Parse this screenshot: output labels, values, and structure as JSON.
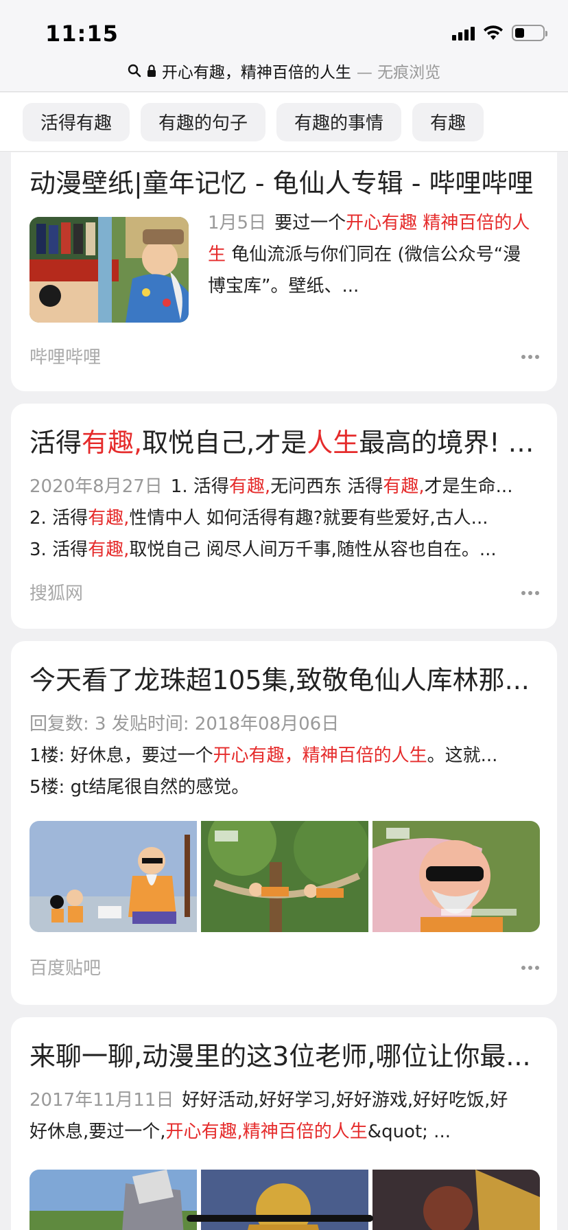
{
  "status": {
    "time": "11:15",
    "battery_level": 0.35
  },
  "url_bar": {
    "title": "开心有趣，精神百倍的人生",
    "mode": "— 无痕浏览"
  },
  "chips": [
    "活得有趣",
    "有趣的句子",
    "有趣的事情",
    "有趣"
  ],
  "results": [
    {
      "title": "动漫壁纸|童年记忆 - 龟仙人专辑 - 哔哩哔哩",
      "date": "1月5日",
      "snippet_parts": [
        "要过一个",
        "开心有趣 精神百倍的人生",
        " 龟仙流派与你们同在 (微信公众号“漫博宝库”。壁纸、..."
      ],
      "source": "哔哩哔哩"
    },
    {
      "title_parts": [
        "活得",
        "有趣,",
        "取悦自己,才是",
        "人生",
        "最高的境界! -..."
      ],
      "date": "2020年8月27日",
      "lines": [
        [
          "1. 活得",
          "有趣,",
          "无问西东 活得",
          "有趣,",
          "才是生命..."
        ],
        [
          "2. 活得",
          "有趣,",
          "性情中人 如何活得有趣?就要有些爱好,古人..."
        ],
        [
          "3. 活得",
          "有趣,",
          "取悦自己 阅尽人间万千事,随性从容也自在。..."
        ]
      ],
      "source": "搜狐网"
    },
    {
      "title": "今天看了龙珠超105集,致敬龟仙人库林那...",
      "meta": "回复数: 3  发贴时间: 2018年08月06日",
      "line1_parts": [
        "1楼: 好休息，要过一个",
        "开心有趣，精神百倍的人生",
        "。这就..."
      ],
      "line2": "5楼: gt结尾很自然的感觉。",
      "source": "百度贴吧"
    },
    {
      "title": "来聊一聊,动漫里的这3位老师,哪位让你最...",
      "date": "2017年11月11日",
      "line1": "好好活动,好好学习,好好游戏,好好吃饭,好",
      "line2_parts": [
        "好休息,要过一个,",
        "开心有趣,精神百倍的人生",
        "&quot; ..."
      ]
    }
  ],
  "colors": {
    "highlight": "#e52b2b",
    "muted": "#999999"
  }
}
